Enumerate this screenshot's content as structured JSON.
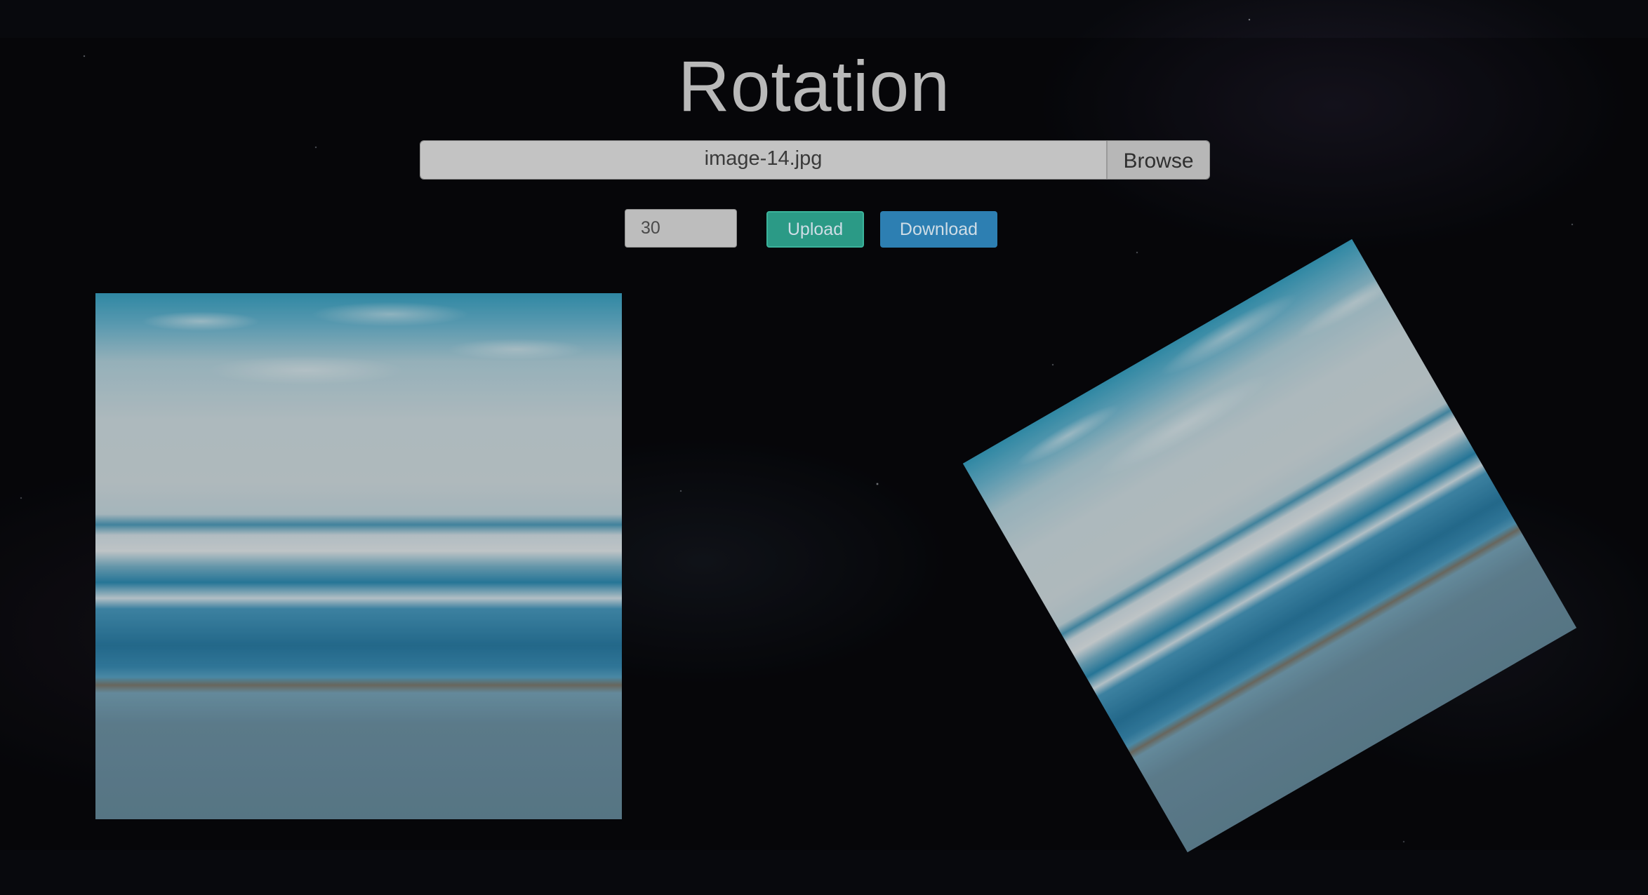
{
  "page": {
    "title": "Rotation"
  },
  "file_picker": {
    "file_name": "image-14.jpg",
    "browse_label": "Browse"
  },
  "controls": {
    "angle_value": "30",
    "upload_label": "Upload",
    "download_label": "Download"
  },
  "images": {
    "original_alt": "beach-photo",
    "rotated_alt": "beach-photo-rotated",
    "rotation_degrees": 30
  },
  "colors": {
    "upload_button": "#2b9a86",
    "download_button": "#2d7fb2",
    "title_text": "#b9b9b9"
  }
}
